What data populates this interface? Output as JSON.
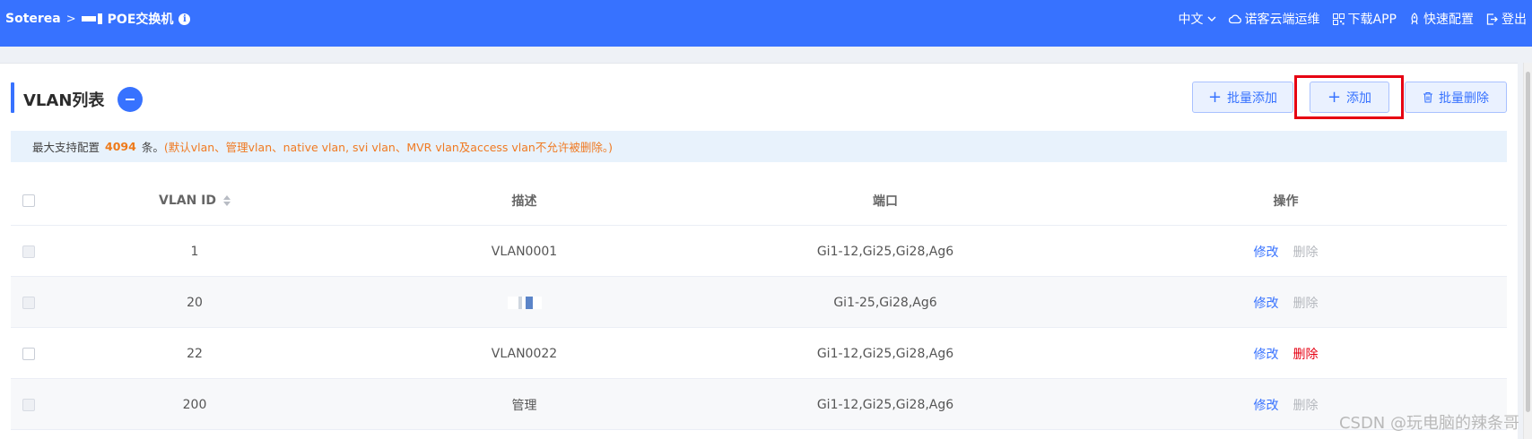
{
  "topbar": {
    "brand": "Soterea",
    "breadcrumb_sep": ">",
    "device_name": "POE交换机",
    "language": "中文",
    "cloud_ops": "诺客云端运维",
    "download_app": "下载APP",
    "quick_config": "快速配置",
    "logout": "登出"
  },
  "panel": {
    "title": "VLAN列表",
    "batch_add_label": "批量添加",
    "add_label": "添加",
    "batch_delete_label": "批量删除"
  },
  "notice": {
    "prefix": "最大支持配置",
    "max_count": "4094",
    "suffix": "条。",
    "tip": "(默认vlan、管理vlan、native vlan, svi vlan、MVR vlan及access vlan不允许被删除。)"
  },
  "table": {
    "headers": {
      "id": "VLAN ID",
      "desc": "描述",
      "ports": "端口",
      "ops": "操作"
    },
    "edit_label": "修改",
    "delete_label": "删除",
    "rows": [
      {
        "id": "1",
        "desc": "VLAN0001",
        "ports": "Gi1-12,Gi25,Gi28,Ag6",
        "deletable": false
      },
      {
        "id": "20",
        "desc": "",
        "ports": "Gi1-25,Gi28,Ag6",
        "deletable": false
      },
      {
        "id": "22",
        "desc": "VLAN0022",
        "ports": "Gi1-12,Gi25,Gi28,Ag6",
        "deletable": true
      },
      {
        "id": "200",
        "desc": "管理",
        "ports": "Gi1-12,Gi25,Gi28,Ag6",
        "deletable": false
      }
    ]
  },
  "watermark": "CSDN @玩电脑的辣条哥",
  "colors": {
    "primary": "#3772ff",
    "danger": "#e60012",
    "warning": "#f07a22",
    "notice_bg": "#e8f2fc"
  }
}
